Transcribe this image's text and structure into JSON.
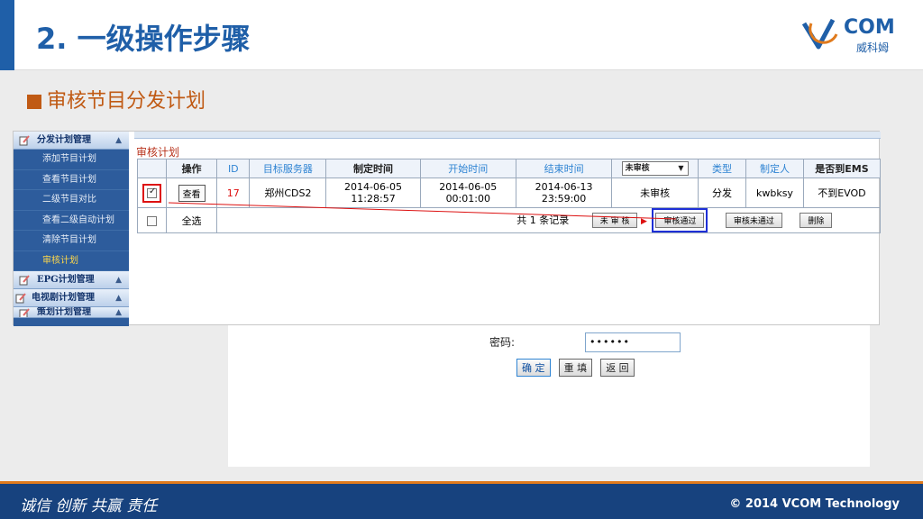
{
  "slide": {
    "title": "2. 一级操作步骤",
    "section": "审核节目分发计划",
    "logo_text": "COM",
    "logo_sub": "威科姆",
    "slogan": "诚信 创新 共赢 责任",
    "copyright": "© 2014 VCOM Technology"
  },
  "sidebar": {
    "groups": [
      {
        "label": "分发计划管理"
      },
      {
        "label": "EPG计划管理"
      },
      {
        "label": "电视剧计划管理"
      },
      {
        "label": "策划计划管理"
      }
    ],
    "items": [
      "添加节目计划",
      "查看节目计划",
      "二级节目对比",
      "查看二级自动计划",
      "清除节目计划",
      "审核计划"
    ]
  },
  "panel": {
    "title": "审核计划",
    "headers": [
      "操作",
      "ID",
      "目标服务器",
      "制定时间",
      "开始时间",
      "结束时间",
      "类型",
      "制定人",
      "是否到EMS"
    ],
    "status_select": "未审核",
    "row": {
      "view_label": "查看",
      "id": "17",
      "server": "郑州CDS2",
      "created": "2014-06-05 11:28:57",
      "start": "2014-06-05 00:01:00",
      "end": "2014-06-13 23:59:00",
      "status": "未审核",
      "type": "分发",
      "creator": "kwbksy",
      "ems": "不到EVOD"
    },
    "footer": {
      "select_all": "全选",
      "count": "共 1 条记录",
      "btn_unreviewed": "未 审 核",
      "btn_pass": "审核通过",
      "btn_fail": "审核未通过",
      "btn_delete": "删除"
    }
  },
  "login": {
    "label": "密码:",
    "value": "••••••",
    "btn_ok": "确 定",
    "btn_reset": "重 填",
    "btn_back": "返 回"
  },
  "colors": {
    "brand": "#1f5fa8",
    "accent": "#c05a14",
    "highlight_red": "#dd1111",
    "highlight_blue": "#1e2fd6"
  }
}
